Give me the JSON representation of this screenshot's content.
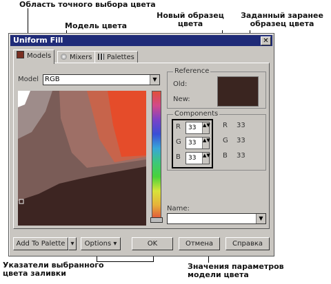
{
  "annotations": {
    "area": "Область точного выбора цвета",
    "model": "Модель цвета",
    "new_sample": "Новый образец цвета",
    "preset_sample": "Заданный заранее образец цвета",
    "pointers": "Указатели выбранного цвета заливки",
    "params": "Значения параметров модели цвета"
  },
  "dialog": {
    "title": "Uniform Fill",
    "close": "✕",
    "tabs": [
      "Models",
      "Mixers",
      "Palettes"
    ],
    "model_label": "Model",
    "model_value": "RGB",
    "reference": {
      "title": "Reference",
      "old": "Old:",
      "new": "New:"
    },
    "components": {
      "title": "Components",
      "rows": [
        {
          "label": "R",
          "value": "33",
          "readout": "33"
        },
        {
          "label": "G",
          "value": "33",
          "readout": "33"
        },
        {
          "label": "B",
          "value": "33",
          "readout": "33"
        }
      ]
    },
    "name_label": "Name:",
    "name_value": "",
    "buttons": {
      "add": "Add To Palette",
      "options": "Options",
      "ok": "OK",
      "cancel": "Отмена",
      "help": "Справка"
    }
  },
  "colors": {
    "selected": "#3a2520",
    "title_bar": "#1f2b78",
    "dialog_bg": "#c9c6c1"
  }
}
